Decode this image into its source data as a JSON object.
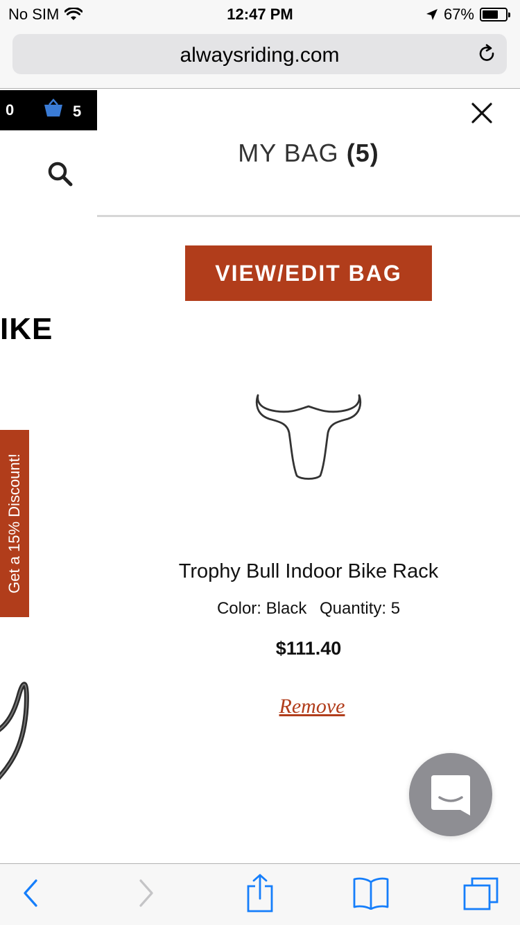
{
  "status_bar": {
    "carrier": "No SIM",
    "time": "12:47 PM",
    "battery": "67%",
    "icons": [
      "wifi-icon",
      "location-arrow-icon",
      "battery-icon"
    ]
  },
  "browser": {
    "url": "alwaysriding.com",
    "reload_icon": "reload-icon"
  },
  "background_page": {
    "cart_left_count": "0",
    "cart_count": "5",
    "heading_fragment": "IKE",
    "discount_tab": "Get a 15% Discount!"
  },
  "bag": {
    "title": "MY BAG",
    "count": "(5)",
    "view_edit_label": "VIEW/EDIT BAG",
    "item": {
      "name": "Trophy Bull Indoor Bike Rack",
      "color": "Color: Black",
      "quantity": "Quantity: 5",
      "price": "$111.40",
      "remove_label": "Remove"
    }
  },
  "colors": {
    "accent": "#b13d1b",
    "ios_blue": "#157efb",
    "bag_icon_blue": "#3a7bd5"
  },
  "toolbar": {
    "icons": [
      "back-icon",
      "forward-icon",
      "share-icon",
      "bookmarks-icon",
      "tabs-icon"
    ]
  }
}
